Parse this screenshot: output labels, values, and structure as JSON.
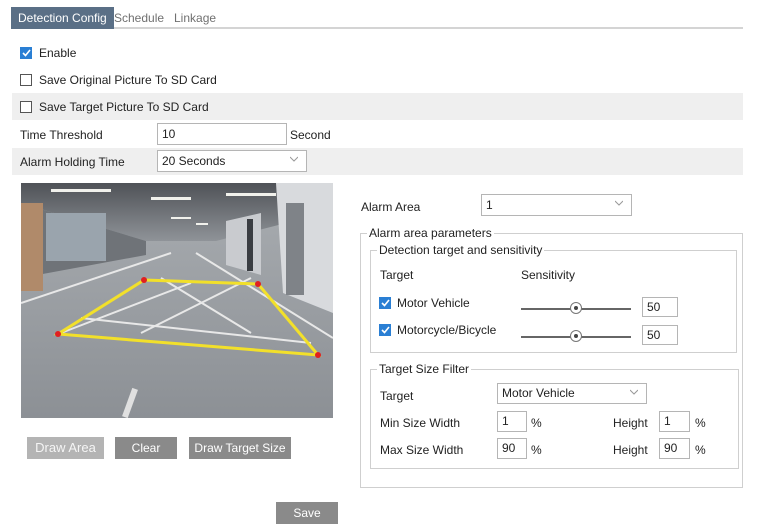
{
  "tabs": [
    {
      "label": "Detection Config"
    },
    {
      "label": "Schedule"
    },
    {
      "label": "Linkage"
    }
  ],
  "options": {
    "enable": {
      "label": "Enable",
      "checked": true
    },
    "save_original": {
      "label": "Save Original Picture To SD Card",
      "checked": false
    },
    "save_target": {
      "label": "Save Target Picture To SD Card",
      "checked": false
    }
  },
  "time_threshold": {
    "label": "Time Threshold",
    "value": "10",
    "unit": "Second"
  },
  "alarm_holding": {
    "label": "Alarm Holding Time",
    "value": "20 Seconds"
  },
  "buttons": {
    "draw_area": "Draw Area",
    "clear": "Clear",
    "draw_target_size": "Draw Target Size",
    "save": "Save"
  },
  "alarm_area": {
    "label": "Alarm Area",
    "value": "1"
  },
  "params": {
    "legend": "Alarm area parameters",
    "detection": {
      "legend": "Detection target and sensitivity",
      "target_header": "Target",
      "sensitivity_header": "Sensitivity",
      "rows": [
        {
          "label": "Motor Vehicle",
          "checked": true,
          "value": "50",
          "level": 50
        },
        {
          "label": "Motorcycle/Bicycle",
          "checked": true,
          "value": "50",
          "level": 50
        }
      ]
    },
    "size_filter": {
      "legend": "Target Size Filter",
      "target_label": "Target",
      "target_value": "Motor Vehicle",
      "min_width_label": "Min Size Width",
      "min_width": "1",
      "min_height_label": "Height",
      "min_height": "1",
      "max_width_label": "Max Size Width",
      "max_width": "90",
      "max_height_label": "Height",
      "max_height": "90",
      "unit": "%"
    }
  },
  "colors": {
    "accent": "#2a7fd4",
    "tab_active": "#5a6f86",
    "zone_line": "#f2e02a",
    "zone_point": "#e02020"
  }
}
